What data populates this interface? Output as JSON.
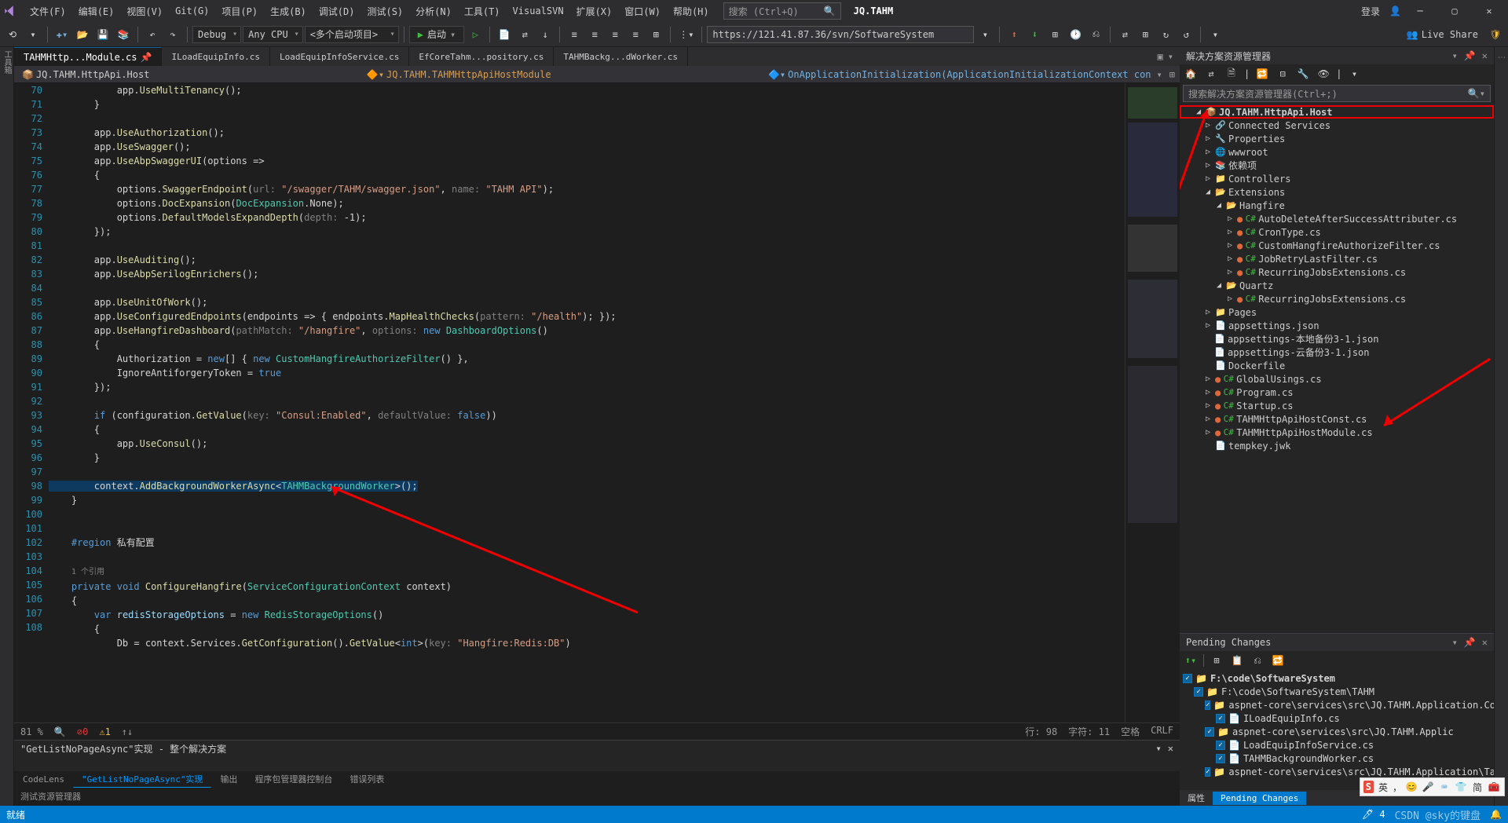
{
  "menubar": {
    "items": [
      "文件(F)",
      "编辑(E)",
      "视图(V)",
      "Git(G)",
      "项目(P)",
      "生成(B)",
      "调试(D)",
      "测试(S)",
      "分析(N)",
      "工具(T)",
      "VisualSVN",
      "扩展(X)",
      "窗口(W)",
      "帮助(H)"
    ],
    "search_placeholder": "搜索 (Ctrl+Q)",
    "project": "JQ.TAHM",
    "login": "登录",
    "liveshare": "Live Share"
  },
  "toolbar": {
    "config": "Debug",
    "platform": "Any CPU",
    "startup": "<多个启动项目>",
    "start": "启动",
    "url": "https://121.41.87.36/svn/SoftwareSystem"
  },
  "tabs": {
    "active": "TAHMHttp...Module.cs",
    "others": [
      "ILoadEquipInfo.cs",
      "LoadEquipInfoService.cs",
      "EfCoreTahm...pository.cs",
      "TAHMBackg...dWorker.cs"
    ]
  },
  "breadcrumb": {
    "a": "JQ.TAHM.HttpApi.Host",
    "b": "JQ.TAHM.TAHMHttpApiHostModule",
    "c": "OnApplicationInitialization(ApplicationInitializationContext con"
  },
  "code": {
    "lines": [
      70,
      71,
      72,
      73,
      74,
      75,
      76,
      77,
      78,
      79,
      80,
      81,
      82,
      83,
      84,
      85,
      86,
      87,
      88,
      89,
      90,
      91,
      92,
      93,
      94,
      95,
      96,
      97,
      98,
      99,
      100,
      101,
      102,
      103,
      104,
      105,
      106,
      107,
      108
    ],
    "ref_hint": "1 个引用",
    "region": "私有配置"
  },
  "editor_status": {
    "pct": "81 %",
    "err": "0",
    "warn": "1",
    "line": "行: 98",
    "col": "字符: 11",
    "spc": "空格",
    "eol": "CRLF"
  },
  "bottom": {
    "find_title": "\"GetListNoPageAsync\"实现 - 整个解决方案",
    "tabs": [
      "CodeLens",
      "\"GetListNoPageAsync\"实现",
      "输出",
      "程序包管理器控制台",
      "错误列表"
    ],
    "extra": "测试资源管理器"
  },
  "solution": {
    "panel_title": "解决方案资源管理器",
    "search_placeholder": "搜索解决方案资源管理器(Ctrl+;)",
    "root": "JQ.TAHM.HttpApi.Host",
    "items": {
      "connected": "Connected Services",
      "properties": "Properties",
      "wwwroot": "wwwroot",
      "deps": "依赖项",
      "controllers": "Controllers",
      "extensions": "Extensions",
      "hangfire": "Hangfire",
      "hf1": "AutoDeleteAfterSuccessAttributer.cs",
      "hf2": "CronType.cs",
      "hf3": "CustomHangfireAuthorizeFilter.cs",
      "hf4": "JobRetryLastFilter.cs",
      "hf5": "RecurringJobsExtensions.cs",
      "quartz": "Quartz",
      "qz1": "RecurringJobsExtensions.cs",
      "pages": "Pages",
      "app1": "appsettings.json",
      "app2": "appsettings-本地备份3-1.json",
      "app3": "appsettings-云备份3-1.json",
      "dockerfile": "Dockerfile",
      "gu": "GlobalUsings.cs",
      "prog": "Program.cs",
      "startup": "Startup.cs",
      "const": "TAHMHttpApiHostConst.cs",
      "module": "TAHMHttpApiHostModule.cs",
      "temp": "tempkey.jwk"
    }
  },
  "pending": {
    "title": "Pending Changes",
    "root": "F:\\code\\SoftwareSystem",
    "folder": "F:\\code\\SoftwareSystem\\TAHM",
    "f1": "aspnet-core\\services\\src\\JQ.TAHM.Application.Contracts\\Jobs",
    "f1a": "ILoadEquipInfo.cs",
    "f2": "aspnet-core\\services\\src\\JQ.TAHM.Applic",
    "f2a": "LoadEquipInfoService.cs",
    "f2b": "TAHMBackgroundWorker.cs",
    "f3": "aspnet-core\\services\\src\\JQ.TAHM.Application\\Tahm\\TahmC..desc"
  },
  "bottom_right_tabs": {
    "a": "属性",
    "b": "Pending Changes"
  },
  "statusbar": {
    "ready": "就绪",
    "count": "4",
    "watermark": "CSDN @sky的键盘"
  },
  "ime": {
    "lang": "英",
    "text": "简"
  }
}
